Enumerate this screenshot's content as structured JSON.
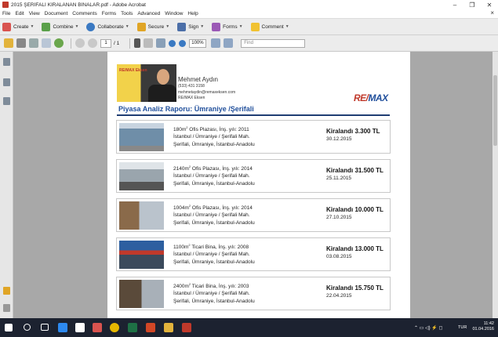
{
  "window": {
    "title": "2015 ŞERİFALİ KİRALANAN BİNALAR.pdf - Adobe Acrobat",
    "minimize": "–",
    "maximize": "❐",
    "close": "✕",
    "doc_close": "×"
  },
  "menu": [
    "File",
    "Edit",
    "View",
    "Document",
    "Comments",
    "Forms",
    "Tools",
    "Advanced",
    "Window",
    "Help"
  ],
  "toolbar1": {
    "create": "Create",
    "combine": "Combine",
    "collaborate": "Collaborate",
    "secure": "Secure",
    "sign": "Sign",
    "forms": "Forms",
    "comment": "Comment"
  },
  "toolbar2": {
    "page_current": "1",
    "page_total": "/ 1",
    "zoom": "100%",
    "find_placeholder": "Find"
  },
  "agent": {
    "name": "Mehmet Aydın",
    "phone": "(533) 431 3158",
    "email": "mehmetaydin@remaxeksen.com",
    "office": "RE/MAX Eksen",
    "badge": "RE/MAX Eksen"
  },
  "brand": {
    "logo_left": "RE/",
    "logo_right": "MAX"
  },
  "report_title": "Piyasa Analiz Raporu:  Ümraniye /Şerifali",
  "listings": [
    {
      "area": "180m",
      "sup": "2",
      "desc": " Ofis Plazası,  İnş. yılı: 2011",
      "address1": "İstanbul / Ümraniye / Şerifali Mah.",
      "address2": "Şerifali, Ümraniye, İstanbul-Anadolu",
      "rent": "Kiralandı 3.300 TL",
      "date": "30.12.2015"
    },
    {
      "area": "2140m",
      "sup": "2",
      "desc": " Ofis Plazası,  İnş. yılı: 2014",
      "address1": "İstanbul / Ümraniye / Şerifali Mah.",
      "address2": "Şerifali, Ümraniye, İstanbul-Anadolu",
      "rent": "Kiralandı 31.500 TL",
      "date": "25.11.2015"
    },
    {
      "area": "1004m",
      "sup": "2",
      "desc": " Ofis Plazası,  İnş. yılı: 2014",
      "address1": "İstanbul / Ümraniye / Şerifali Mah.",
      "address2": "Şerifali, Ümraniye, İstanbul-Anadolu",
      "rent": "Kiralandı 10.000 TL",
      "date": "27.10.2015"
    },
    {
      "area": "1100m",
      "sup": "2",
      "desc": " Ticari Bina,  İnş. yılı: 2008",
      "address1": "İstanbul / Ümraniye / Şerifali Mah.",
      "address2": "Şerifali, Ümraniye, İstanbul-Anadolu",
      "rent": "Kiralandı 13.000 TL",
      "date": "03.08.2015"
    },
    {
      "area": "2400m",
      "sup": "2",
      "desc": " Ticari Bina,  İnş. yılı: 2003",
      "address1": "İstanbul / Ümraniye / Şerifali Mah.",
      "address2": "Şerifali, Ümraniye, İstanbul-Anadolu",
      "rent": "Kiralandı 15.750 TL",
      "date": "22.04.2015"
    }
  ],
  "taskbar": {
    "lang": "TUR",
    "time": "11:42",
    "date": "01.04.2016",
    "tray_icons": "⌃ ▭ ◁) ⚡ ◻"
  },
  "colors": {
    "accent_blue": "#1f4e9b",
    "remax_red": "#c0392b",
    "taskbar": "#1c2230"
  }
}
